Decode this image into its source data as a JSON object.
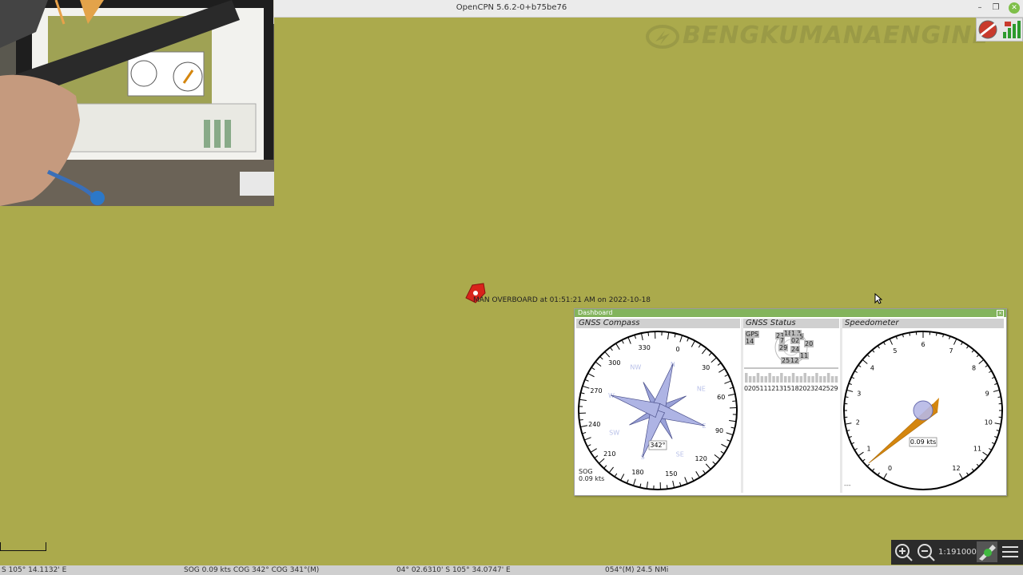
{
  "window": {
    "title": "OpenCPN 5.6.2-0+b75be76"
  },
  "watermark": {
    "text": "BENGKUMANAENGINE"
  },
  "mob": {
    "label": "MAN OVERBOARD at 01:51:21 AM on 2022-10-18"
  },
  "dashboard": {
    "title": "Dashboard",
    "compass": {
      "title": "GNSS Compass",
      "heading": "342°",
      "sog_label": "SOG",
      "sog_value": "0.09 kts",
      "ticks": [
        "0",
        "30",
        "60",
        "90",
        "120",
        "150",
        "180",
        "210",
        "240",
        "270",
        "300",
        "330"
      ],
      "cardinals": [
        "NE",
        "E",
        "SE",
        "S",
        "SW",
        "W",
        "NW",
        "N"
      ]
    },
    "gnss": {
      "title": "GNSS Status",
      "gps_label": "GPS",
      "gps_count": "14",
      "sats": [
        "23",
        "18",
        "15",
        "3",
        "5",
        "7",
        "02",
        "20",
        "29",
        "24",
        "11",
        "25",
        "12"
      ],
      "prn_axis": "020511121315182023242529"
    },
    "speedometer": {
      "title": "Speedometer",
      "value": "0.09 kts",
      "ticks": [
        "0",
        "1",
        "2",
        "3",
        "4",
        "5",
        "6",
        "7",
        "8",
        "9",
        "10",
        "11",
        "12"
      ],
      "footer": "---"
    }
  },
  "toolbar": {
    "scale": "1:191000"
  },
  "status": {
    "position": "S  105° 14.1132' E",
    "sog_cog": "SOG 0.09 kts  COG 342°  COG 341°(M)",
    "cursor_pos": "04° 02.6310' S   105° 34.0747' E",
    "bearing": "054°(M)  24.5 NMi"
  },
  "colors": {
    "chart_bg": "#abaa4c",
    "dashboard_header": "#83b45c",
    "speed_needle": "#d4860e",
    "mob": "#d9231b"
  }
}
